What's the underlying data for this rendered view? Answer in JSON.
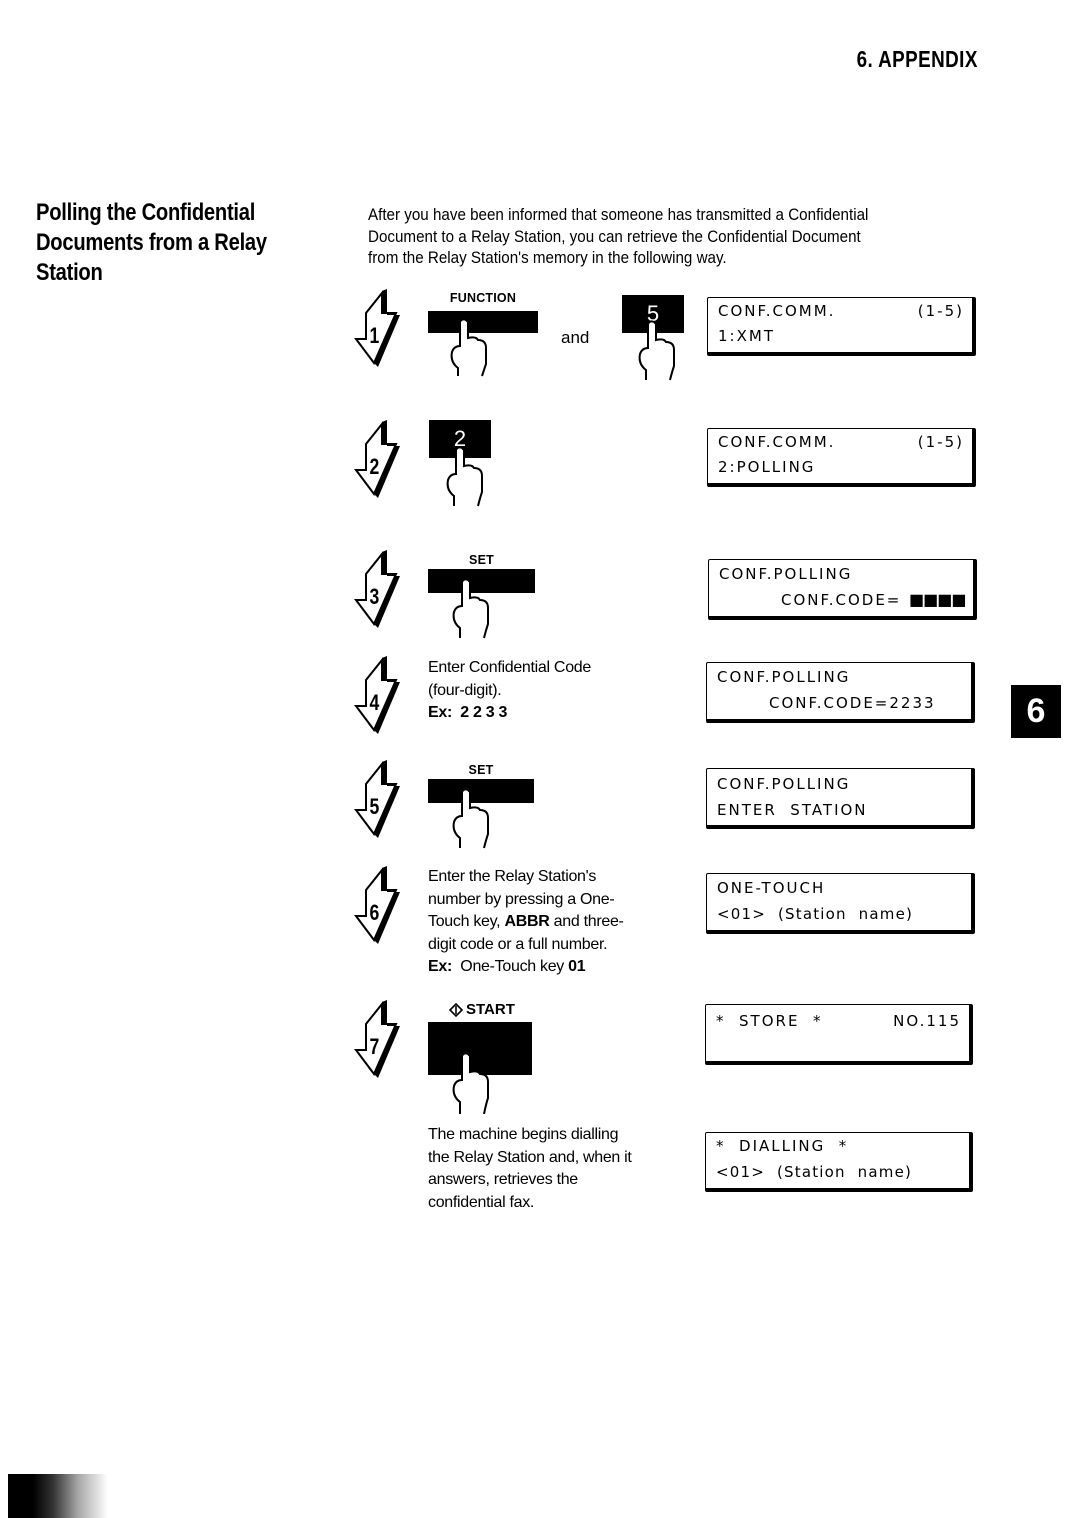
{
  "header": {
    "chapter": "6.  APPENDIX"
  },
  "section": {
    "title_lines": [
      "Polling the Confidential",
      "Documents from a Relay",
      "Station"
    ],
    "intro_lines": [
      "After you have been informed that someone has transmitted a Confidential",
      "Document to a Relay Station, you can retrieve the Confidential Document",
      "from the Relay Station's memory in the following way."
    ]
  },
  "steps": [
    {
      "number": "1",
      "keys": [
        {
          "label": "FUNCTION",
          "icon": "finger-press-icon"
        },
        {
          "digit": "5",
          "icon": "finger-press-icon"
        }
      ],
      "connector": "and",
      "display": [
        "CONF.COMM.",
        "(1-5)",
        "1:XMT"
      ]
    },
    {
      "number": "2",
      "keys": [
        {
          "digit": "2",
          "icon": "finger-press-icon"
        }
      ],
      "display": [
        "CONF.COMM.",
        "(1-5)",
        "2:POLLING"
      ]
    },
    {
      "number": "3",
      "keys": [
        {
          "label": "SET",
          "icon": "finger-press-icon"
        }
      ],
      "display": [
        "CONF.POLLING",
        "CONF.CODE=",
        "■■■■"
      ]
    },
    {
      "number": "4",
      "text_lines": [
        "Enter Confidential Code",
        "(four-digit)."
      ],
      "example_label": "Ex:",
      "example_value": "2 2 3 3",
      "display": [
        "CONF.POLLING",
        "CONF.CODE=2233"
      ]
    },
    {
      "number": "5",
      "keys": [
        {
          "label": "SET",
          "icon": "finger-press-icon"
        }
      ],
      "display": [
        "CONF.POLLING",
        "ENTER  STATION"
      ]
    },
    {
      "number": "6",
      "text_lines": [
        "Enter the Relay Station's",
        "number by pressing a One-",
        "Touch key, ",
        "ABBR",
        " and three-",
        "digit code or a full number."
      ],
      "example_label": "Ex:",
      "example_text": "One-Touch key ",
      "example_value": "01",
      "display": [
        "ONE-TOUCH",
        "<01>  (Station  name)"
      ]
    },
    {
      "number": "7",
      "keys": [
        {
          "label": "START",
          "icon": "start-diamond-icon"
        }
      ],
      "text_lines": [
        "The machine begins dialling",
        "the Relay Station and, when it",
        "answers, retrieves the",
        "confidential fax."
      ],
      "display": [
        "*  STORE  *",
        "NO.115"
      ],
      "display2": [
        "*  DIALLING  *",
        "<01>  (Station  name)"
      ]
    }
  ],
  "side_tab": "6"
}
